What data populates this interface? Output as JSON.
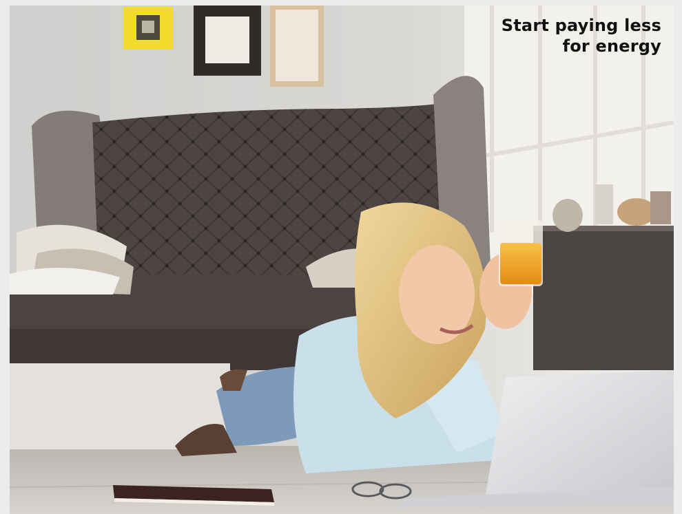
{
  "banner": {
    "headline_line1": "Start paying less",
    "headline_line2": "for energy"
  },
  "scene": {
    "subject": "photo-woman-on-floor-with-laptop-and-juice",
    "colors": {
      "wall": "#d6d6d4",
      "floor": "#c7c3bd",
      "sofa": "#4e4643",
      "hair": "#e3c07c",
      "laptop": "#e2e3e5",
      "juice": "#f2a81d",
      "frame_yellow": "#f1dc2a"
    }
  }
}
